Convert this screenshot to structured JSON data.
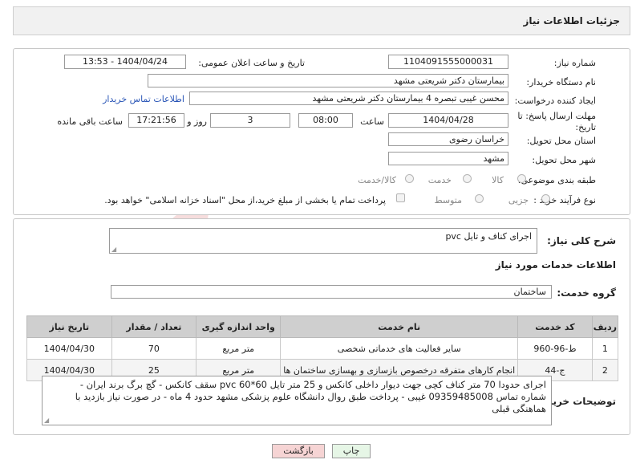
{
  "header": {
    "title": "جزئیات اطلاعات نیاز"
  },
  "form": {
    "need_number_label": "شماره نیاز:",
    "need_number": "1104091555000031",
    "announce_label": "تاریخ و ساعت اعلان عمومی:",
    "announce_value": "1404/04/24 - 13:53",
    "buyer_org_label": "نام دستگاه خریدار:",
    "buyer_org": "بیمارستان دکتر شریعتی مشهد",
    "creator_label": "ایجاد کننده درخواست:",
    "creator": "محسن غیبی تبصره 4 بیمارستان دکتر شریعتی مشهد",
    "contact_link": "اطلاعات تماس خریدار",
    "deadline_label": "مهلت ارسال پاسخ: تا تاریخ:",
    "deadline_date": "1404/04/28",
    "time_label": "ساعت",
    "deadline_time": "08:00",
    "days_value": "3",
    "days_label": "روز و",
    "remaining_time": "17:21:56",
    "remaining_label": "ساعت باقی مانده",
    "province_label": "استان محل تحویل:",
    "province": "خراسان رضوی",
    "city_label": "شهر محل تحویل:",
    "city": "مشهد",
    "category_label": "طبقه بندی موضوعی:",
    "category_options": [
      "کالا",
      "خدمت",
      "کالا/خدمت"
    ],
    "purchase_type_label": "نوع فرآیند خرید :",
    "purchase_options": [
      "جزیی",
      "متوسط"
    ],
    "payment_note": "پرداخت تمام یا بخشی از مبلغ خرید،از محل \"اسناد خزانه اسلامی\" خواهد بود."
  },
  "summary": {
    "label": "شرح کلی نیاز:",
    "value": "اجرای کناف و  تایل pvc"
  },
  "services": {
    "section_title": "اطلاعات خدمات مورد نیاز",
    "group_label": "گروه خدمت:",
    "group_value": "ساختمان",
    "columns": [
      "ردیف",
      "کد خدمت",
      "نام خدمت",
      "واحد اندازه گیری",
      "تعداد / مقدار",
      "تاریخ نیاز"
    ],
    "rows": [
      {
        "row": "1",
        "code": "ط-96-960",
        "name": "سایر فعالیت های خدماتی شخصی",
        "unit": "متر مربع",
        "qty": "70",
        "date": "1404/04/30"
      },
      {
        "row": "2",
        "code": "ج-44",
        "name": "انجام کارهای متفرقه درخصوص بازسازی و بهسازی ساختمان ها",
        "unit": "متر مربع",
        "qty": "25",
        "date": "1404/04/30"
      }
    ]
  },
  "notes": {
    "label": "توضیحات خریدار:",
    "line1": "اجرای حدودا 70 متر کناف کچی جهت دیوار داخلی کانکس  و 25 متر تایل 60*60 pvc سقف کانکس - گچ برگ برند ایران -",
    "line2": "شماره تماس 09359485008 غیبی - پرداخت طبق روال دانشگاه علوم پزشکی مشهد حدود 4 ماه - در صورت نیاز بازدید با",
    "line3": "هماهنگی قبلی"
  },
  "buttons": {
    "print": "چاپ",
    "back": "بازگشت"
  },
  "watermark": {
    "text": "AriaTender.net"
  },
  "colors": {
    "accent_red": "#d33",
    "link": "#2a56b7",
    "header_bg": "#f1f1f1",
    "back_btn_bg": "#f6d4d4",
    "print_btn_bg": "#e6f6e6"
  }
}
